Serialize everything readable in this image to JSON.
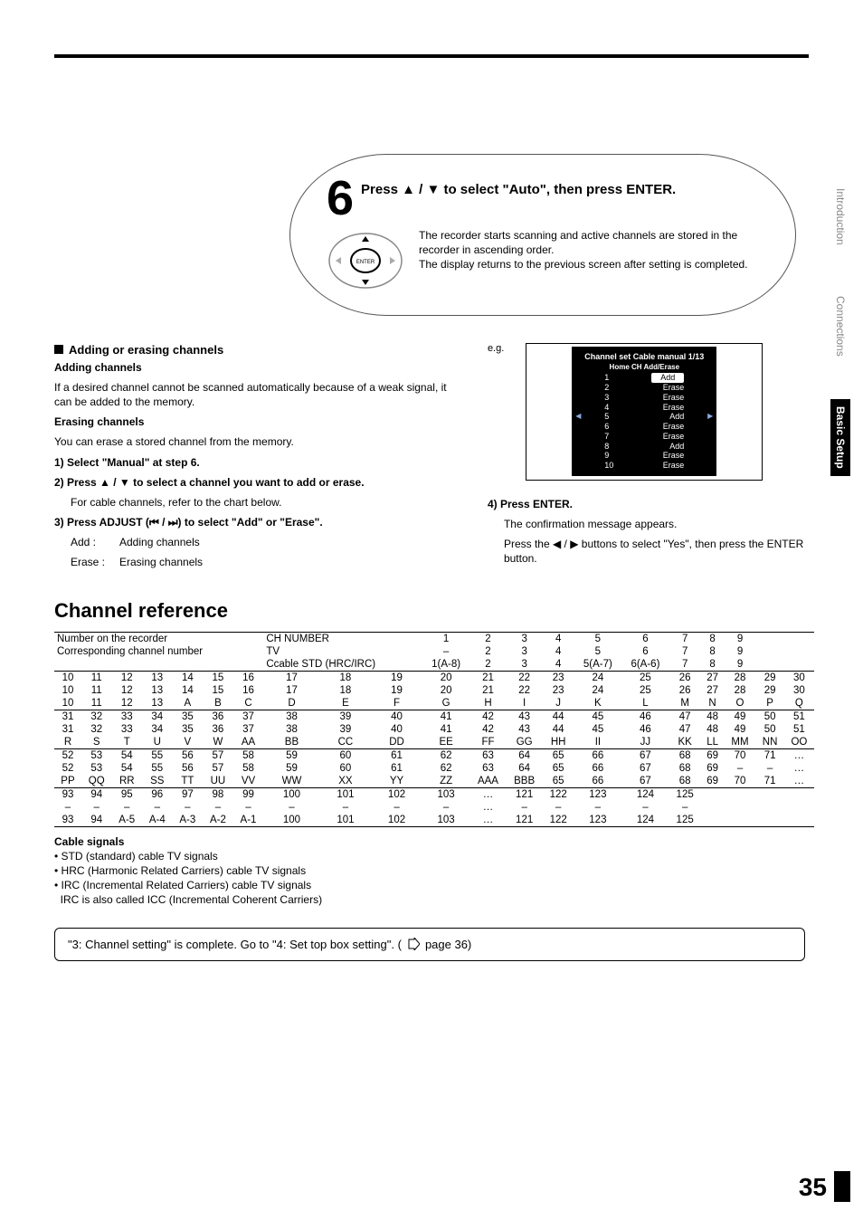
{
  "side_tabs": {
    "intro": "Introduction",
    "conn": "Connections",
    "basic": "Basic Setup"
  },
  "step": {
    "number": "6",
    "title_part1": "Press ",
    "title_arrows": "▲ / ▼",
    "title_part2": " to select \"Auto\", then press ENTER.",
    "body": "The recorder starts scanning and active channels are stored in the recorder in ascending order.\nThe display returns to the previous screen after setting is completed.",
    "enter_label": "ENTER"
  },
  "left": {
    "h1": "Adding or erasing channels",
    "h2a": "Adding channels",
    "p1": "If a desired channel cannot be scanned automatically because of a weak signal, it can be added to the memory.",
    "h2b": "Erasing channels",
    "p2": "You can erase a stored channel from the memory.",
    "s1": "1)  Select \"Manual\" at step 6.",
    "s2_a": "2)  Press ",
    "s2_arrows": "▲ / ▼",
    "s2_b": " to select a channel you want to add or erase.",
    "s2_note": "For cable channels, refer to the chart below.",
    "s3_a": "3)  Press ADJUST (",
    "s3_icons": "⏮ / ⏭",
    "s3_b": ") to select \"Add\" or \"Erase\".",
    "add_l": "Add :",
    "add_v": "Adding channels",
    "erase_l": "Erase :",
    "erase_v": "Erasing channels"
  },
  "right": {
    "eg": "e.g.",
    "osd_title": "Channel set Cable manual  1/13",
    "osd_header": "Home CH   Add/Erase",
    "rows": [
      {
        "ch": "1",
        "val": "Add",
        "hl": true
      },
      {
        "ch": "2",
        "val": "Erase"
      },
      {
        "ch": "3",
        "val": "Erase"
      },
      {
        "ch": "4",
        "val": "Erase"
      },
      {
        "ch": "5",
        "val": "Add"
      },
      {
        "ch": "6",
        "val": "Erase"
      },
      {
        "ch": "7",
        "val": "Erase"
      },
      {
        "ch": "8",
        "val": "Add"
      },
      {
        "ch": "9",
        "val": "Erase"
      },
      {
        "ch": "10",
        "val": "Erase"
      }
    ],
    "s4": "4)  Press ENTER.",
    "s4_p1": "The confirmation message appears.",
    "s4_p2a": "Press the ",
    "s4_arrows": "◀ / ▶",
    "s4_p2b": " buttons to select \"Yes\", then press the ENTER button."
  },
  "section_title": "Channel reference",
  "table": {
    "head_left": [
      "Number on the recorder",
      "Corresponding channel number"
    ],
    "head_right_l1": [
      "CH NUMBER",
      "",
      "1",
      "2",
      "3",
      "4",
      "5",
      "6",
      "7",
      "8",
      "9"
    ],
    "head_right_l2": [
      "TV",
      "",
      "–",
      "2",
      "3",
      "4",
      "5",
      "6",
      "7",
      "8",
      "9"
    ],
    "head_right_l3": [
      "Ccable STD (HRC/IRC)",
      "",
      "1(A-8)",
      "2",
      "3",
      "4",
      "5(A-7)",
      "6(A-6)",
      "7",
      "8",
      "9"
    ],
    "groups": [
      [
        [
          "10",
          "11",
          "12",
          "13",
          "14",
          "15",
          "16",
          "17",
          "18",
          "19",
          "20",
          "21",
          "22",
          "23",
          "24",
          "25",
          "26",
          "27",
          "28",
          "29",
          "30"
        ],
        [
          "10",
          "11",
          "12",
          "13",
          "14",
          "15",
          "16",
          "17",
          "18",
          "19",
          "20",
          "21",
          "22",
          "23",
          "24",
          "25",
          "26",
          "27",
          "28",
          "29",
          "30"
        ],
        [
          "10",
          "11",
          "12",
          "13",
          "A",
          "B",
          "C",
          "D",
          "E",
          "F",
          "G",
          "H",
          "I",
          "J",
          "K",
          "L",
          "M",
          "N",
          "O",
          "P",
          "Q"
        ]
      ],
      [
        [
          "31",
          "32",
          "33",
          "34",
          "35",
          "36",
          "37",
          "38",
          "39",
          "40",
          "41",
          "42",
          "43",
          "44",
          "45",
          "46",
          "47",
          "48",
          "49",
          "50",
          "51"
        ],
        [
          "31",
          "32",
          "33",
          "34",
          "35",
          "36",
          "37",
          "38",
          "39",
          "40",
          "41",
          "42",
          "43",
          "44",
          "45",
          "46",
          "47",
          "48",
          "49",
          "50",
          "51"
        ],
        [
          "R",
          "S",
          "T",
          "U",
          "V",
          "W",
          "AA",
          "BB",
          "CC",
          "DD",
          "EE",
          "FF",
          "GG",
          "HH",
          "II",
          "JJ",
          "KK",
          "LL",
          "MM",
          "NN",
          "OO"
        ]
      ],
      [
        [
          "52",
          "53",
          "54",
          "55",
          "56",
          "57",
          "58",
          "59",
          "60",
          "61",
          "62",
          "63",
          "64",
          "65",
          "66",
          "67",
          "68",
          "69",
          "70",
          "71",
          "…"
        ],
        [
          "52",
          "53",
          "54",
          "55",
          "56",
          "57",
          "58",
          "59",
          "60",
          "61",
          "62",
          "63",
          "64",
          "65",
          "66",
          "67",
          "68",
          "69",
          "–",
          "–",
          "…"
        ],
        [
          "PP",
          "QQ",
          "RR",
          "SS",
          "TT",
          "UU",
          "VV",
          "WW",
          "XX",
          "YY",
          "ZZ",
          "AAA",
          "BBB",
          "65",
          "66",
          "67",
          "68",
          "69",
          "70",
          "71",
          "…"
        ]
      ],
      [
        [
          "93",
          "94",
          "95",
          "96",
          "97",
          "98",
          "99",
          "100",
          "101",
          "102",
          "103",
          "…",
          "121",
          "122",
          "123",
          "124",
          "125",
          "",
          "",
          "",
          ""
        ],
        [
          "–",
          "–",
          "–",
          "–",
          "–",
          "–",
          "–",
          "–",
          "–",
          "–",
          "–",
          "…",
          "–",
          "–",
          "–",
          "–",
          "–",
          "",
          "",
          "",
          ""
        ],
        [
          "93",
          "94",
          "A-5",
          "A-4",
          "A-3",
          "A-2",
          "A-1",
          "100",
          "101",
          "102",
          "103",
          "…",
          "121",
          "122",
          "123",
          "124",
          "125",
          "",
          "",
          "",
          ""
        ]
      ]
    ]
  },
  "signals": {
    "h": "Cable signals",
    "l1": "• STD (standard) cable TV signals",
    "l2": "• HRC (Harmonic Related Carriers) cable TV signals",
    "l3": "• IRC (Incremental Related Carriers) cable TV signals",
    "l4": "  IRC is also called ICC (Incremental Coherent Carriers)"
  },
  "callout": {
    "text_a": "\"3: Channel setting\" is complete. Go to \"4: Set top box setting\". (",
    "text_b": " page 36)"
  },
  "page_number": "35"
}
